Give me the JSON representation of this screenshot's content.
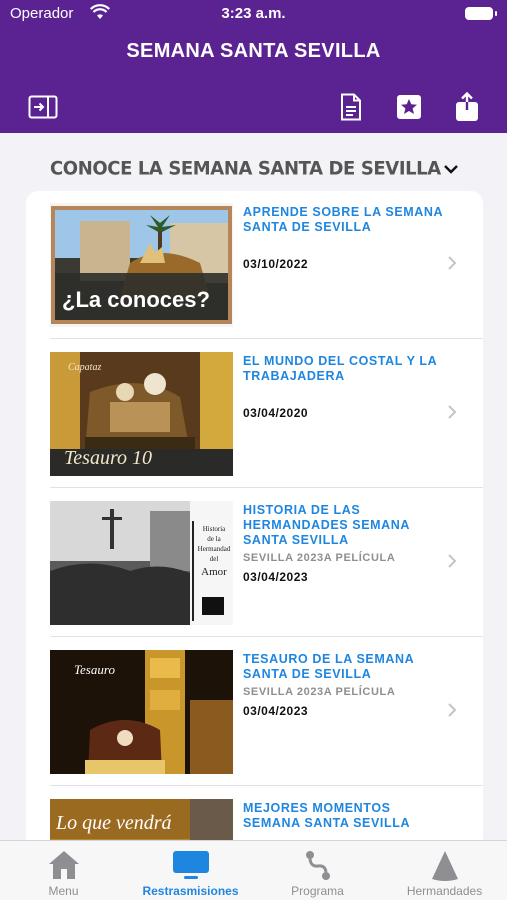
{
  "status_bar": {
    "carrier": "Operador",
    "time": "3:23 a.m."
  },
  "header": {
    "title": "SEMANA SANTA SEVILLA"
  },
  "toolbar": {
    "left_icon": "sidebar-toggle-icon",
    "right_icons": [
      "document-icon",
      "star-icon",
      "share-icon"
    ]
  },
  "section": {
    "title": "CONOCE LA SEMANA SANTA DE SEVILLA"
  },
  "items": [
    {
      "title": "APRENDE SOBRE LA SEMANA SANTA DE SEVILLA",
      "subtitle": "",
      "date": "03/10/2022",
      "thumb_text": "¿La conoces?"
    },
    {
      "title": "EL MUNDO DEL COSTAL Y LA TRABAJADERA",
      "subtitle": "",
      "date": "03/04/2020",
      "thumb_text": "Tesauro 10",
      "thumb_caption": "Capataz"
    },
    {
      "title": "HISTORIA DE LAS HERMANDADES SEMANA SANTA SEVILLA",
      "subtitle": "SEVILLA 2023A PELÍCULA",
      "date": "03/04/2023",
      "thumb_text": "Historia de la Hermandad del Amor"
    },
    {
      "title": "TESAURO DE LA SEMANA SANTA DE SEVILLA",
      "subtitle": "SEVILLA 2023A PELÍCULA",
      "date": "03/04/2023",
      "thumb_text": "Tesauro"
    },
    {
      "title": "MEJORES MOMENTOS SEMANA SANTA SEVILLA",
      "subtitle": "",
      "date": "",
      "thumb_text": "Lo que vendrá"
    }
  ],
  "tabs": [
    {
      "label": "Menu",
      "icon": "home-icon",
      "active": false
    },
    {
      "label": "Restrasmisiones",
      "icon": "tv-icon",
      "active": true
    },
    {
      "label": "Programa",
      "icon": "route-icon",
      "active": false
    },
    {
      "label": "Hermandades",
      "icon": "nazareno-icon",
      "active": false
    }
  ],
  "colors": {
    "header": "#5b2391",
    "accent": "#1f86e0"
  }
}
